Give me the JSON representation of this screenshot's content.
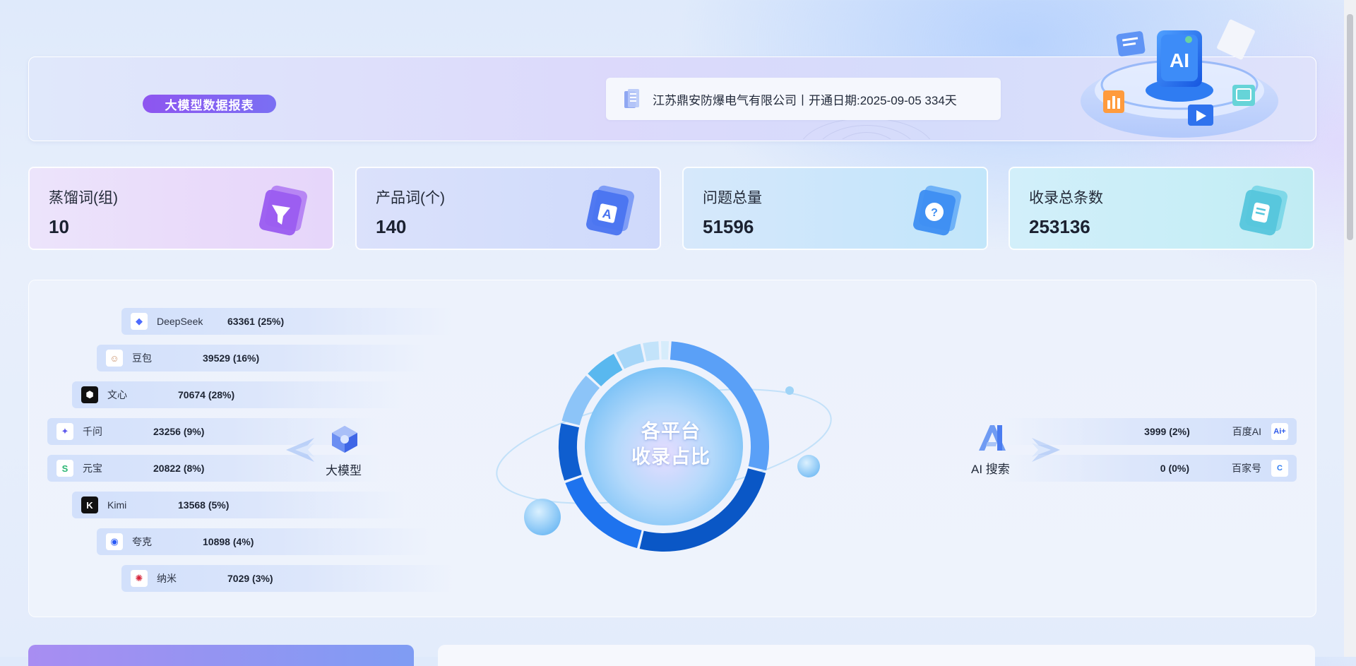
{
  "header": {
    "report_tag": "大模型数据报表",
    "company_line": "江苏鼎安防爆电气有限公司丨开通日期:2025-09-05 334天",
    "illustration_label": "AI"
  },
  "kpis": [
    {
      "label": "蒸馏词(组)",
      "value": "10",
      "icon": "funnel-icon"
    },
    {
      "label": "产品词(个)",
      "value": "140",
      "icon": "letter-a-icon"
    },
    {
      "label": "问题总量",
      "value": "51596",
      "icon": "question-bubble-icon"
    },
    {
      "label": "收录总条数",
      "value": "253136",
      "icon": "document-icon"
    }
  ],
  "platforms": {
    "left_hub_label": "大模型",
    "right_hub_label": "AI 搜索",
    "center_line1": "各平台",
    "center_line2": "收录占比",
    "models": [
      {
        "name": "DeepSeek",
        "value": "63361 (25%)",
        "count": 63361,
        "color": "#4d6bfe"
      },
      {
        "name": "豆包",
        "value": "39529 (16%)",
        "count": 39529,
        "color": "#c88f6a"
      },
      {
        "name": "文心",
        "value": "70674 (28%)",
        "count": 70674,
        "color": "#111111"
      },
      {
        "name": "千问",
        "value": "23256 (9%)",
        "count": 23256,
        "color": "#615ced"
      },
      {
        "name": "元宝",
        "value": "20822 (8%)",
        "count": 20822,
        "color": "#2bb673"
      },
      {
        "name": "Kimi",
        "value": "13568 (5%)",
        "count": 13568,
        "color": "#111111"
      },
      {
        "name": "夸克",
        "value": "10898 (4%)",
        "count": 10898,
        "color": "#2b5bf6"
      },
      {
        "name": "纳米",
        "value": "7029 (3%)",
        "count": 7029,
        "color": "#d6243a"
      }
    ],
    "search": [
      {
        "name": "百度AI",
        "value": "3999 (2%)",
        "count": 3999,
        "logo_text": "Ai+"
      },
      {
        "name": "百家号",
        "value": "0 (0%)",
        "count": 0,
        "logo_text": "C"
      }
    ]
  },
  "colors": {
    "accent_purple": "#8e55f0",
    "ring_dark": "#0a57c6",
    "ring_mid": "#1e73ee",
    "ring_light": "#5aa0f7",
    "ring_pale": "#8cc4f8"
  }
}
